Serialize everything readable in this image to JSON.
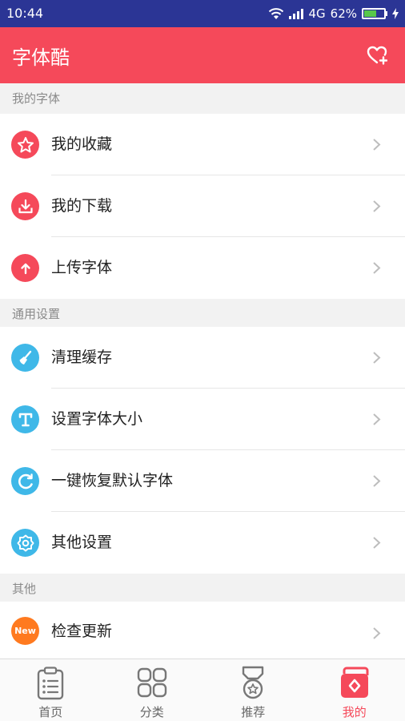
{
  "status": {
    "time": "10:44",
    "network": "4G",
    "battery": "62%",
    "battery_level": 0.62
  },
  "header": {
    "title": "字体酷",
    "fav_icon": "heart-plus-icon"
  },
  "sections": [
    {
      "title": "我的字体",
      "items": [
        {
          "label": "我的收藏",
          "icon": "star-icon",
          "color": "#f5495a"
        },
        {
          "label": "我的下载",
          "icon": "download-icon",
          "color": "#f5495a"
        },
        {
          "label": "上传字体",
          "icon": "upload-arrow-icon",
          "color": "#f5495a"
        }
      ]
    },
    {
      "title": "通用设置",
      "items": [
        {
          "label": "清理缓存",
          "icon": "broom-icon",
          "color": "#3fb8e8"
        },
        {
          "label": "设置字体大小",
          "icon": "font-size-icon",
          "color": "#3fb8e8"
        },
        {
          "label": "一键恢复默认字体",
          "icon": "restore-icon",
          "color": "#3fb8e8"
        },
        {
          "label": "其他设置",
          "icon": "settings-icon",
          "color": "#3fb8e8"
        }
      ]
    },
    {
      "title": "其他",
      "items": [
        {
          "label": "检查更新",
          "icon": "new-badge-icon",
          "color": "#ff7a1f",
          "badge": "New"
        }
      ]
    }
  ],
  "tabs": [
    {
      "label": "首页",
      "icon": "clipboard-list-icon",
      "active": false
    },
    {
      "label": "分类",
      "icon": "grid-icon",
      "active": false
    },
    {
      "label": "推荐",
      "icon": "medal-icon",
      "active": false
    },
    {
      "label": "我的",
      "icon": "profile-card-icon",
      "active": true
    }
  ],
  "colors": {
    "accent": "#f5495a",
    "statusbar": "#2b3595",
    "blue_icon": "#3fb8e8",
    "orange_icon": "#ff7a1f"
  }
}
